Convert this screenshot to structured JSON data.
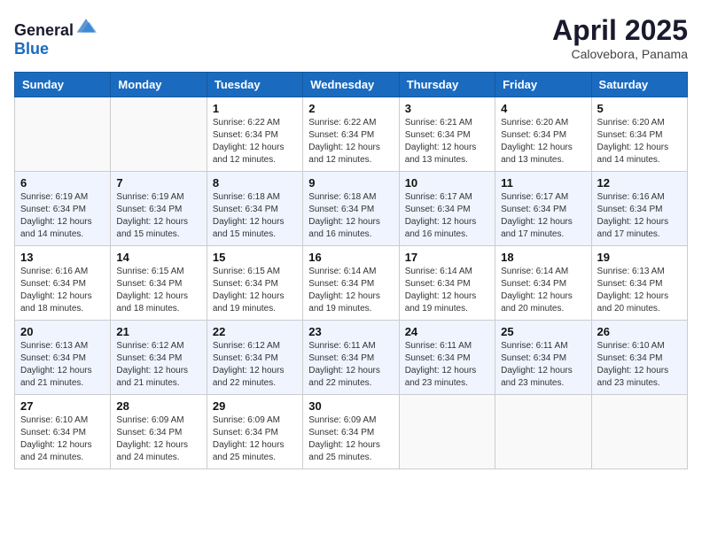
{
  "header": {
    "logo_general": "General",
    "logo_blue": "Blue",
    "month_title": "April 2025",
    "subtitle": "Calovebora, Panama"
  },
  "days_of_week": [
    "Sunday",
    "Monday",
    "Tuesday",
    "Wednesday",
    "Thursday",
    "Friday",
    "Saturday"
  ],
  "weeks": [
    [
      {
        "day": "",
        "sunrise": "",
        "sunset": "",
        "daylight": ""
      },
      {
        "day": "",
        "sunrise": "",
        "sunset": "",
        "daylight": ""
      },
      {
        "day": "1",
        "sunrise": "Sunrise: 6:22 AM",
        "sunset": "Sunset: 6:34 PM",
        "daylight": "Daylight: 12 hours and 12 minutes."
      },
      {
        "day": "2",
        "sunrise": "Sunrise: 6:22 AM",
        "sunset": "Sunset: 6:34 PM",
        "daylight": "Daylight: 12 hours and 12 minutes."
      },
      {
        "day": "3",
        "sunrise": "Sunrise: 6:21 AM",
        "sunset": "Sunset: 6:34 PM",
        "daylight": "Daylight: 12 hours and 13 minutes."
      },
      {
        "day": "4",
        "sunrise": "Sunrise: 6:20 AM",
        "sunset": "Sunset: 6:34 PM",
        "daylight": "Daylight: 12 hours and 13 minutes."
      },
      {
        "day": "5",
        "sunrise": "Sunrise: 6:20 AM",
        "sunset": "Sunset: 6:34 PM",
        "daylight": "Daylight: 12 hours and 14 minutes."
      }
    ],
    [
      {
        "day": "6",
        "sunrise": "Sunrise: 6:19 AM",
        "sunset": "Sunset: 6:34 PM",
        "daylight": "Daylight: 12 hours and 14 minutes."
      },
      {
        "day": "7",
        "sunrise": "Sunrise: 6:19 AM",
        "sunset": "Sunset: 6:34 PM",
        "daylight": "Daylight: 12 hours and 15 minutes."
      },
      {
        "day": "8",
        "sunrise": "Sunrise: 6:18 AM",
        "sunset": "Sunset: 6:34 PM",
        "daylight": "Daylight: 12 hours and 15 minutes."
      },
      {
        "day": "9",
        "sunrise": "Sunrise: 6:18 AM",
        "sunset": "Sunset: 6:34 PM",
        "daylight": "Daylight: 12 hours and 16 minutes."
      },
      {
        "day": "10",
        "sunrise": "Sunrise: 6:17 AM",
        "sunset": "Sunset: 6:34 PM",
        "daylight": "Daylight: 12 hours and 16 minutes."
      },
      {
        "day": "11",
        "sunrise": "Sunrise: 6:17 AM",
        "sunset": "Sunset: 6:34 PM",
        "daylight": "Daylight: 12 hours and 17 minutes."
      },
      {
        "day": "12",
        "sunrise": "Sunrise: 6:16 AM",
        "sunset": "Sunset: 6:34 PM",
        "daylight": "Daylight: 12 hours and 17 minutes."
      }
    ],
    [
      {
        "day": "13",
        "sunrise": "Sunrise: 6:16 AM",
        "sunset": "Sunset: 6:34 PM",
        "daylight": "Daylight: 12 hours and 18 minutes."
      },
      {
        "day": "14",
        "sunrise": "Sunrise: 6:15 AM",
        "sunset": "Sunset: 6:34 PM",
        "daylight": "Daylight: 12 hours and 18 minutes."
      },
      {
        "day": "15",
        "sunrise": "Sunrise: 6:15 AM",
        "sunset": "Sunset: 6:34 PM",
        "daylight": "Daylight: 12 hours and 19 minutes."
      },
      {
        "day": "16",
        "sunrise": "Sunrise: 6:14 AM",
        "sunset": "Sunset: 6:34 PM",
        "daylight": "Daylight: 12 hours and 19 minutes."
      },
      {
        "day": "17",
        "sunrise": "Sunrise: 6:14 AM",
        "sunset": "Sunset: 6:34 PM",
        "daylight": "Daylight: 12 hours and 19 minutes."
      },
      {
        "day": "18",
        "sunrise": "Sunrise: 6:14 AM",
        "sunset": "Sunset: 6:34 PM",
        "daylight": "Daylight: 12 hours and 20 minutes."
      },
      {
        "day": "19",
        "sunrise": "Sunrise: 6:13 AM",
        "sunset": "Sunset: 6:34 PM",
        "daylight": "Daylight: 12 hours and 20 minutes."
      }
    ],
    [
      {
        "day": "20",
        "sunrise": "Sunrise: 6:13 AM",
        "sunset": "Sunset: 6:34 PM",
        "daylight": "Daylight: 12 hours and 21 minutes."
      },
      {
        "day": "21",
        "sunrise": "Sunrise: 6:12 AM",
        "sunset": "Sunset: 6:34 PM",
        "daylight": "Daylight: 12 hours and 21 minutes."
      },
      {
        "day": "22",
        "sunrise": "Sunrise: 6:12 AM",
        "sunset": "Sunset: 6:34 PM",
        "daylight": "Daylight: 12 hours and 22 minutes."
      },
      {
        "day": "23",
        "sunrise": "Sunrise: 6:11 AM",
        "sunset": "Sunset: 6:34 PM",
        "daylight": "Daylight: 12 hours and 22 minutes."
      },
      {
        "day": "24",
        "sunrise": "Sunrise: 6:11 AM",
        "sunset": "Sunset: 6:34 PM",
        "daylight": "Daylight: 12 hours and 23 minutes."
      },
      {
        "day": "25",
        "sunrise": "Sunrise: 6:11 AM",
        "sunset": "Sunset: 6:34 PM",
        "daylight": "Daylight: 12 hours and 23 minutes."
      },
      {
        "day": "26",
        "sunrise": "Sunrise: 6:10 AM",
        "sunset": "Sunset: 6:34 PM",
        "daylight": "Daylight: 12 hours and 23 minutes."
      }
    ],
    [
      {
        "day": "27",
        "sunrise": "Sunrise: 6:10 AM",
        "sunset": "Sunset: 6:34 PM",
        "daylight": "Daylight: 12 hours and 24 minutes."
      },
      {
        "day": "28",
        "sunrise": "Sunrise: 6:09 AM",
        "sunset": "Sunset: 6:34 PM",
        "daylight": "Daylight: 12 hours and 24 minutes."
      },
      {
        "day": "29",
        "sunrise": "Sunrise: 6:09 AM",
        "sunset": "Sunset: 6:34 PM",
        "daylight": "Daylight: 12 hours and 25 minutes."
      },
      {
        "day": "30",
        "sunrise": "Sunrise: 6:09 AM",
        "sunset": "Sunset: 6:34 PM",
        "daylight": "Daylight: 12 hours and 25 minutes."
      },
      {
        "day": "",
        "sunrise": "",
        "sunset": "",
        "daylight": ""
      },
      {
        "day": "",
        "sunrise": "",
        "sunset": "",
        "daylight": ""
      },
      {
        "day": "",
        "sunrise": "",
        "sunset": "",
        "daylight": ""
      }
    ]
  ]
}
